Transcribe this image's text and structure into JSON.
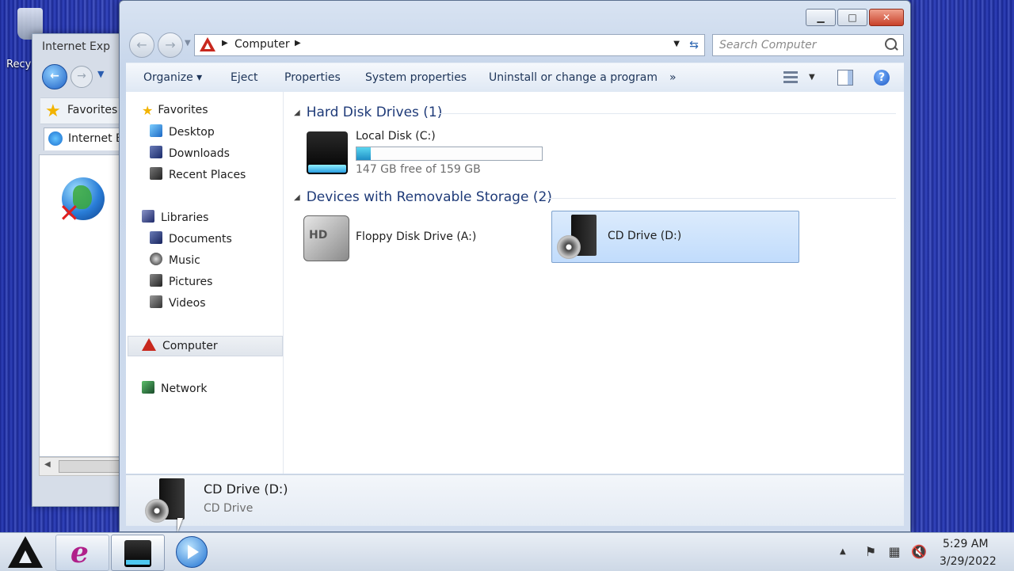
{
  "desktop": {
    "recycle_label": "Recy"
  },
  "ie_window": {
    "title": "Internet Exp",
    "favorites_label": "Favorites",
    "tab_label": "Internet E"
  },
  "window": {
    "address": {
      "location": "Computer"
    },
    "search": {
      "placeholder": "Search Computer"
    },
    "toolbar": {
      "organize": "Organize ▾",
      "eject": "Eject",
      "properties": "Properties",
      "system_properties": "System properties",
      "uninstall": "Uninstall or change a program",
      "more": "»"
    },
    "nav": {
      "favorites": "Favorites",
      "desktop": "Desktop",
      "downloads": "Downloads",
      "recent_places": "Recent Places",
      "libraries": "Libraries",
      "documents": "Documents",
      "music": "Music",
      "pictures": "Pictures",
      "videos": "Videos",
      "computer": "Computer",
      "network": "Network"
    },
    "groups": {
      "hard_disk": "Hard Disk Drives (1)",
      "removable": "Devices with Removable Storage (2)"
    },
    "drives": {
      "local_disk": {
        "name": "Local Disk (C:)",
        "free_text": "147 GB free of 159 GB",
        "used_fraction": 0.075
      },
      "floppy": {
        "name": "Floppy Disk Drive (A:)"
      },
      "cd": {
        "name": "CD Drive (D:)"
      }
    },
    "details": {
      "title": "CD Drive (D:)",
      "type": "CD Drive"
    }
  },
  "taskbar": {
    "time": "5:29 AM",
    "date": "3/29/2022"
  },
  "colors": {
    "accent": "#c8281e",
    "selection": "#c1dcfc",
    "disk_fill": "#1f8fc6"
  }
}
